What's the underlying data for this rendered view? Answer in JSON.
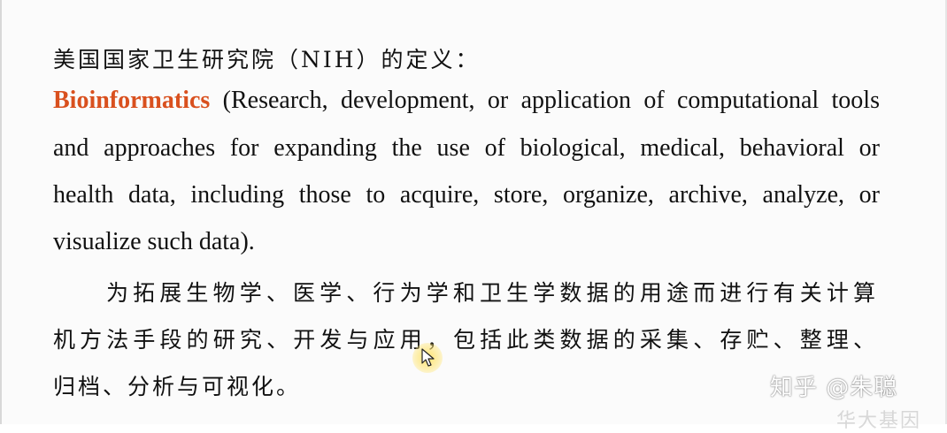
{
  "heading": "美国国家卫生研究院（NIH）的定义：",
  "definition": {
    "keyword": "Bioinformatics",
    "line1_rest": " (Research, development, or application of computational tools",
    "line2": "and approaches for expanding the use of biological, medical, behavioral or",
    "line3": "health data, including those to acquire, store, organize, archive, analyze, or",
    "line4": "visualize such data)."
  },
  "translation": {
    "line1": "为拓展生物学、医学、行为学和卫生学数据的用途而进行有关计算",
    "line2": "机方法手段的研究、开发与应用，包括此类数据的采集、存贮、整理、",
    "line3": "归档、分析与可视化。"
  },
  "watermark": "知乎 @朱聪",
  "corner_fragment": "华大基因",
  "colors": {
    "keyword": "#d9501e",
    "text": "#111111",
    "cursor_highlight": "#ffe05a"
  }
}
